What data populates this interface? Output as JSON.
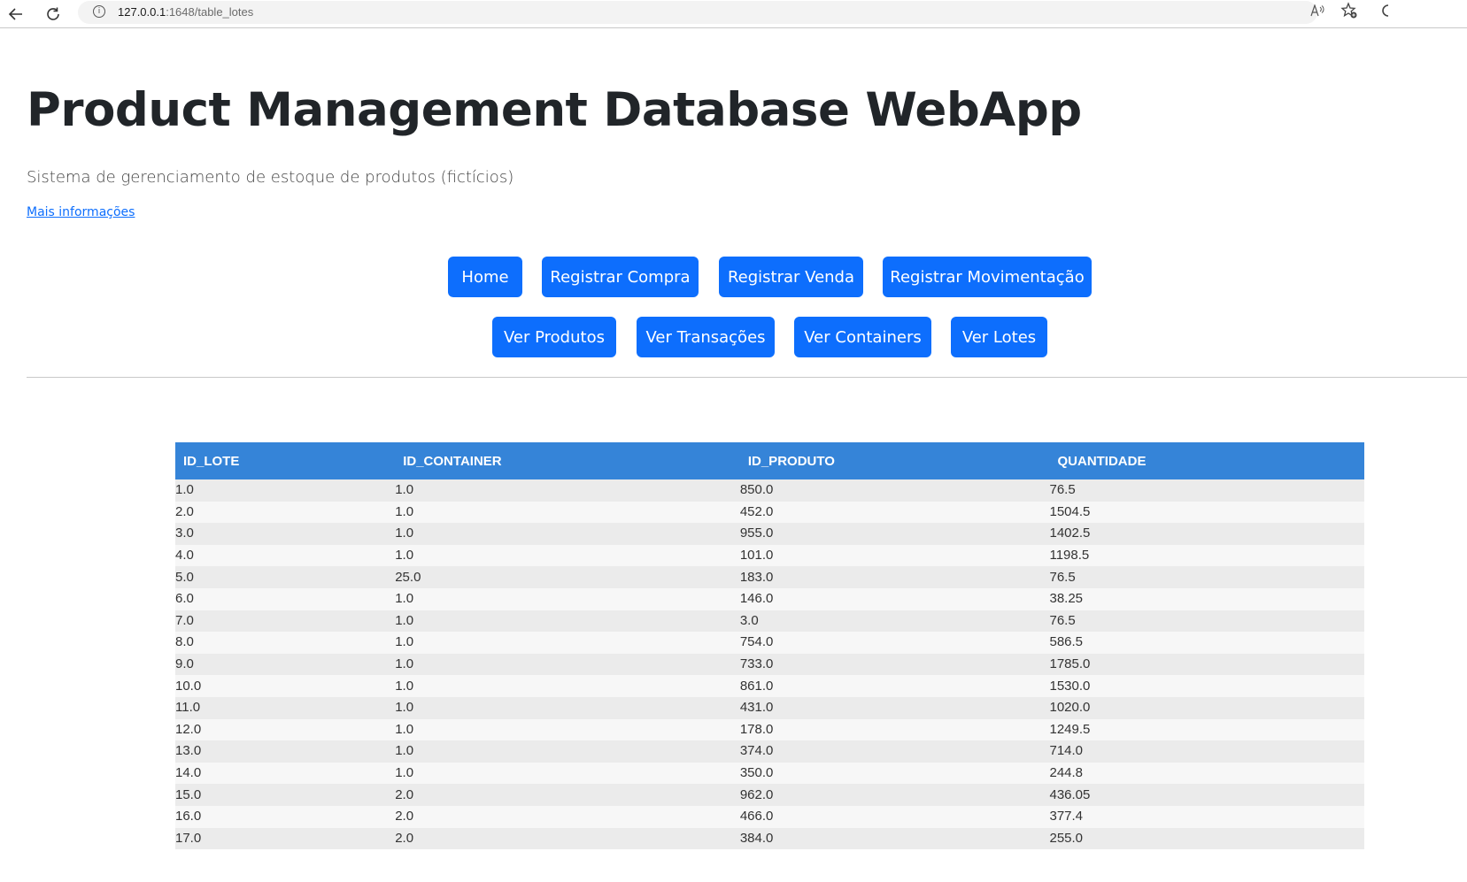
{
  "browser": {
    "back_icon": "arrow-left",
    "reload_icon": "reload",
    "url_host": "127.0.0.1",
    "url_rest": ":1648/table_lotes",
    "read_aloud_icon": "À",
    "favorite_icon": "star-plus"
  },
  "header": {
    "title": "Product Management Database WebApp",
    "subtitle": "Sistema de gerenciamento de estoque de produtos (fictícios)",
    "more_link": "Mais informações"
  },
  "nav": {
    "row1": [
      "Home",
      "Registrar Compra",
      "Registrar Venda",
      "Registrar Movimentação"
    ],
    "row2": [
      "Ver Produtos",
      "Ver Transações",
      "Ver Containers",
      "Ver Lotes"
    ]
  },
  "table": {
    "columns": [
      "ID_LOTE",
      "ID_CONTAINER",
      "ID_PRODUTO",
      "QUANTIDADE"
    ],
    "rows": [
      [
        "1.0",
        "1.0",
        "850.0",
        "76.5"
      ],
      [
        "2.0",
        "1.0",
        "452.0",
        "1504.5"
      ],
      [
        "3.0",
        "1.0",
        "955.0",
        "1402.5"
      ],
      [
        "4.0",
        "1.0",
        "101.0",
        "1198.5"
      ],
      [
        "5.0",
        "25.0",
        "183.0",
        "76.5"
      ],
      [
        "6.0",
        "1.0",
        "146.0",
        "38.25"
      ],
      [
        "7.0",
        "1.0",
        "3.0",
        "76.5"
      ],
      [
        "8.0",
        "1.0",
        "754.0",
        "586.5"
      ],
      [
        "9.0",
        "1.0",
        "733.0",
        "1785.0"
      ],
      [
        "10.0",
        "1.0",
        "861.0",
        "1530.0"
      ],
      [
        "11.0",
        "1.0",
        "431.0",
        "1020.0"
      ],
      [
        "12.0",
        "1.0",
        "178.0",
        "1249.5"
      ],
      [
        "13.0",
        "1.0",
        "374.0",
        "714.0"
      ],
      [
        "14.0",
        "1.0",
        "350.0",
        "244.8"
      ],
      [
        "15.0",
        "2.0",
        "962.0",
        "436.05"
      ],
      [
        "16.0",
        "2.0",
        "466.0",
        "377.4"
      ],
      [
        "17.0",
        "2.0",
        "384.0",
        "255.0"
      ]
    ]
  }
}
